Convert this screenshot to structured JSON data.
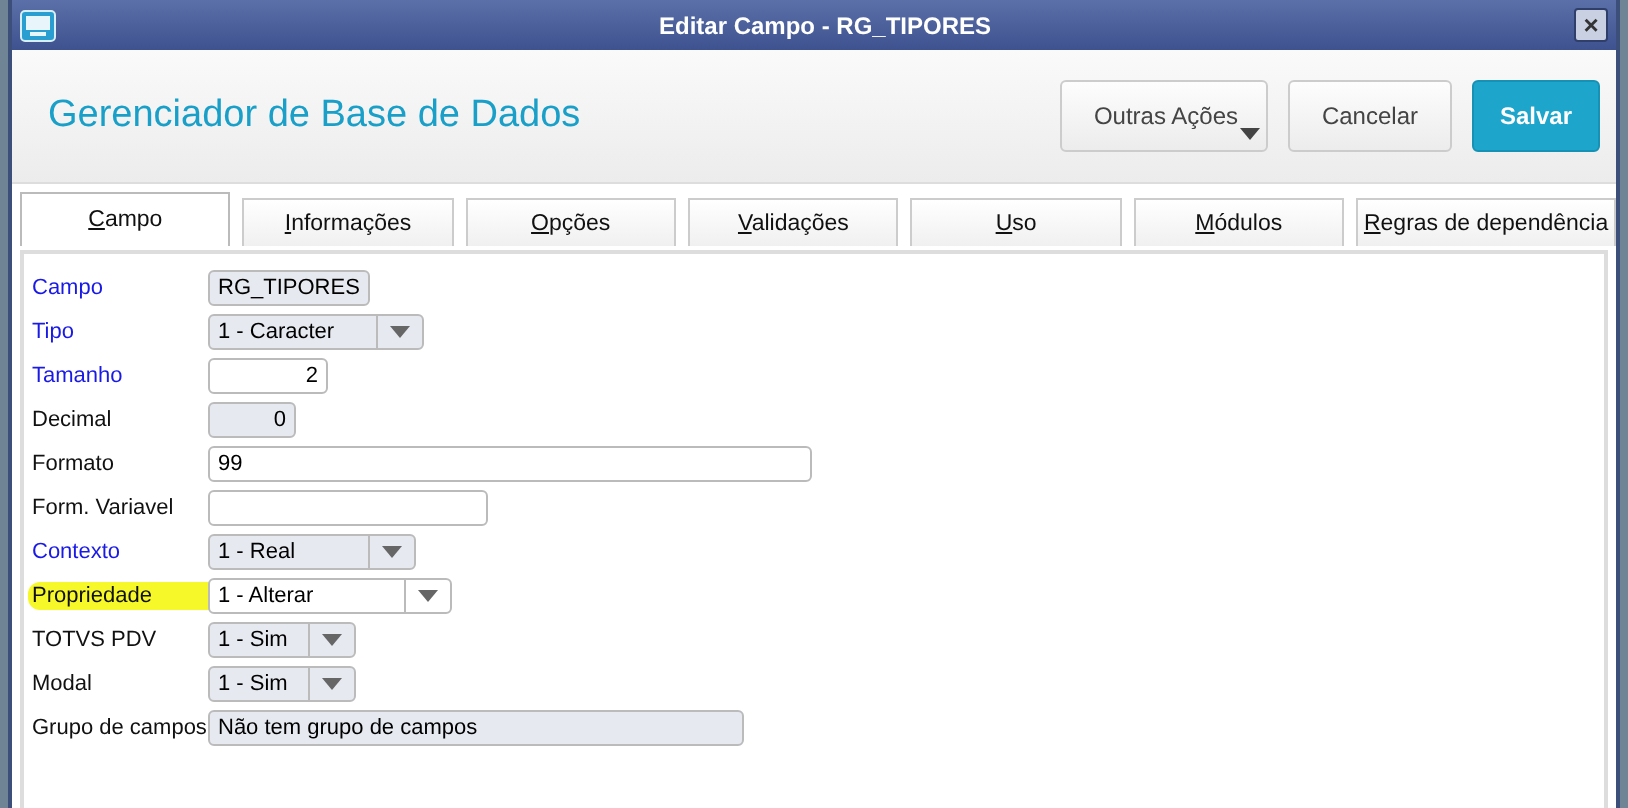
{
  "window": {
    "title": "Editar Campo - RG_TIPORES",
    "close": "×"
  },
  "header": {
    "title": "Gerenciador de Base de Dados",
    "buttons": [
      {
        "label": "Outras Ações",
        "kind": "menu"
      },
      {
        "label": "Cancelar",
        "kind": "plain"
      },
      {
        "label": "Salvar",
        "kind": "primary"
      }
    ]
  },
  "tabs": [
    {
      "label": "Campo",
      "selected": true
    },
    {
      "label": "Informações",
      "selected": false
    },
    {
      "label": "Opções",
      "selected": false
    },
    {
      "label": "Validações",
      "selected": false
    },
    {
      "label": "Uso",
      "selected": false
    },
    {
      "label": "Módulos",
      "selected": false
    },
    {
      "label": "Regras de dependência",
      "selected": false
    }
  ],
  "fields": [
    {
      "label": "Campo",
      "required": true,
      "kind": "text",
      "value": "RG_TIPORES",
      "disabled": true,
      "highlighted": false
    },
    {
      "label": "Tipo",
      "required": true,
      "kind": "select",
      "value": "1 - Caracter",
      "disabled": true,
      "highlighted": false
    },
    {
      "label": "Tamanho",
      "required": true,
      "kind": "number",
      "value": "2",
      "disabled": false,
      "highlighted": false
    },
    {
      "label": "Decimal",
      "required": false,
      "kind": "number",
      "value": "0",
      "disabled": true,
      "highlighted": false
    },
    {
      "label": "Formato",
      "required": false,
      "kind": "text",
      "value": "99",
      "disabled": false,
      "highlighted": false
    },
    {
      "label": "Form. Variavel",
      "required": false,
      "kind": "text",
      "disabled": false,
      "highlighted": false
    },
    {
      "label": "Contexto",
      "required": true,
      "kind": "select",
      "value": "1 - Real",
      "disabled": true,
      "highlighted": false
    },
    {
      "label": "Propriedade",
      "required": false,
      "kind": "select",
      "value": "1 - Alterar",
      "disabled": false,
      "highlighted": true
    },
    {
      "label": "TOTVS PDV",
      "required": false,
      "kind": "select",
      "value": "1 - Sim",
      "disabled": true,
      "highlighted": false
    },
    {
      "label": "Modal",
      "required": false,
      "kind": "select",
      "value": "1 - Sim",
      "disabled": true,
      "highlighted": false
    },
    {
      "label": "Grupo de campos",
      "required": false,
      "kind": "text",
      "value": "Não tem grupo de campos",
      "disabled": true,
      "highlighted": false
    }
  ]
}
